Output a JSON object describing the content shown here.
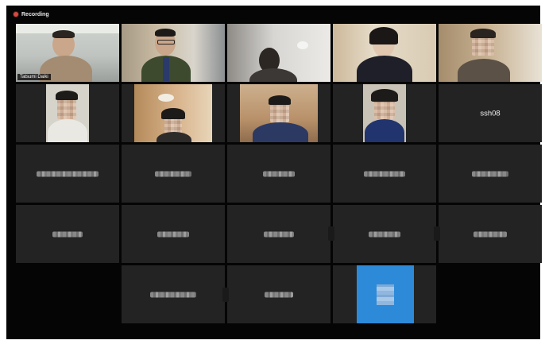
{
  "recording": {
    "label": "Recording",
    "indicator_color": "#d9493e"
  },
  "speaker": {
    "name": "Tatsumi Daiki",
    "highlight_color": "#b6e05a"
  },
  "named_tile": {
    "name": "ssh08"
  },
  "colors": {
    "tile_bg": "#232323",
    "window_bg": "#050505",
    "avatar_blue": "#2d8ad8"
  },
  "participants_total_tiles": 23
}
